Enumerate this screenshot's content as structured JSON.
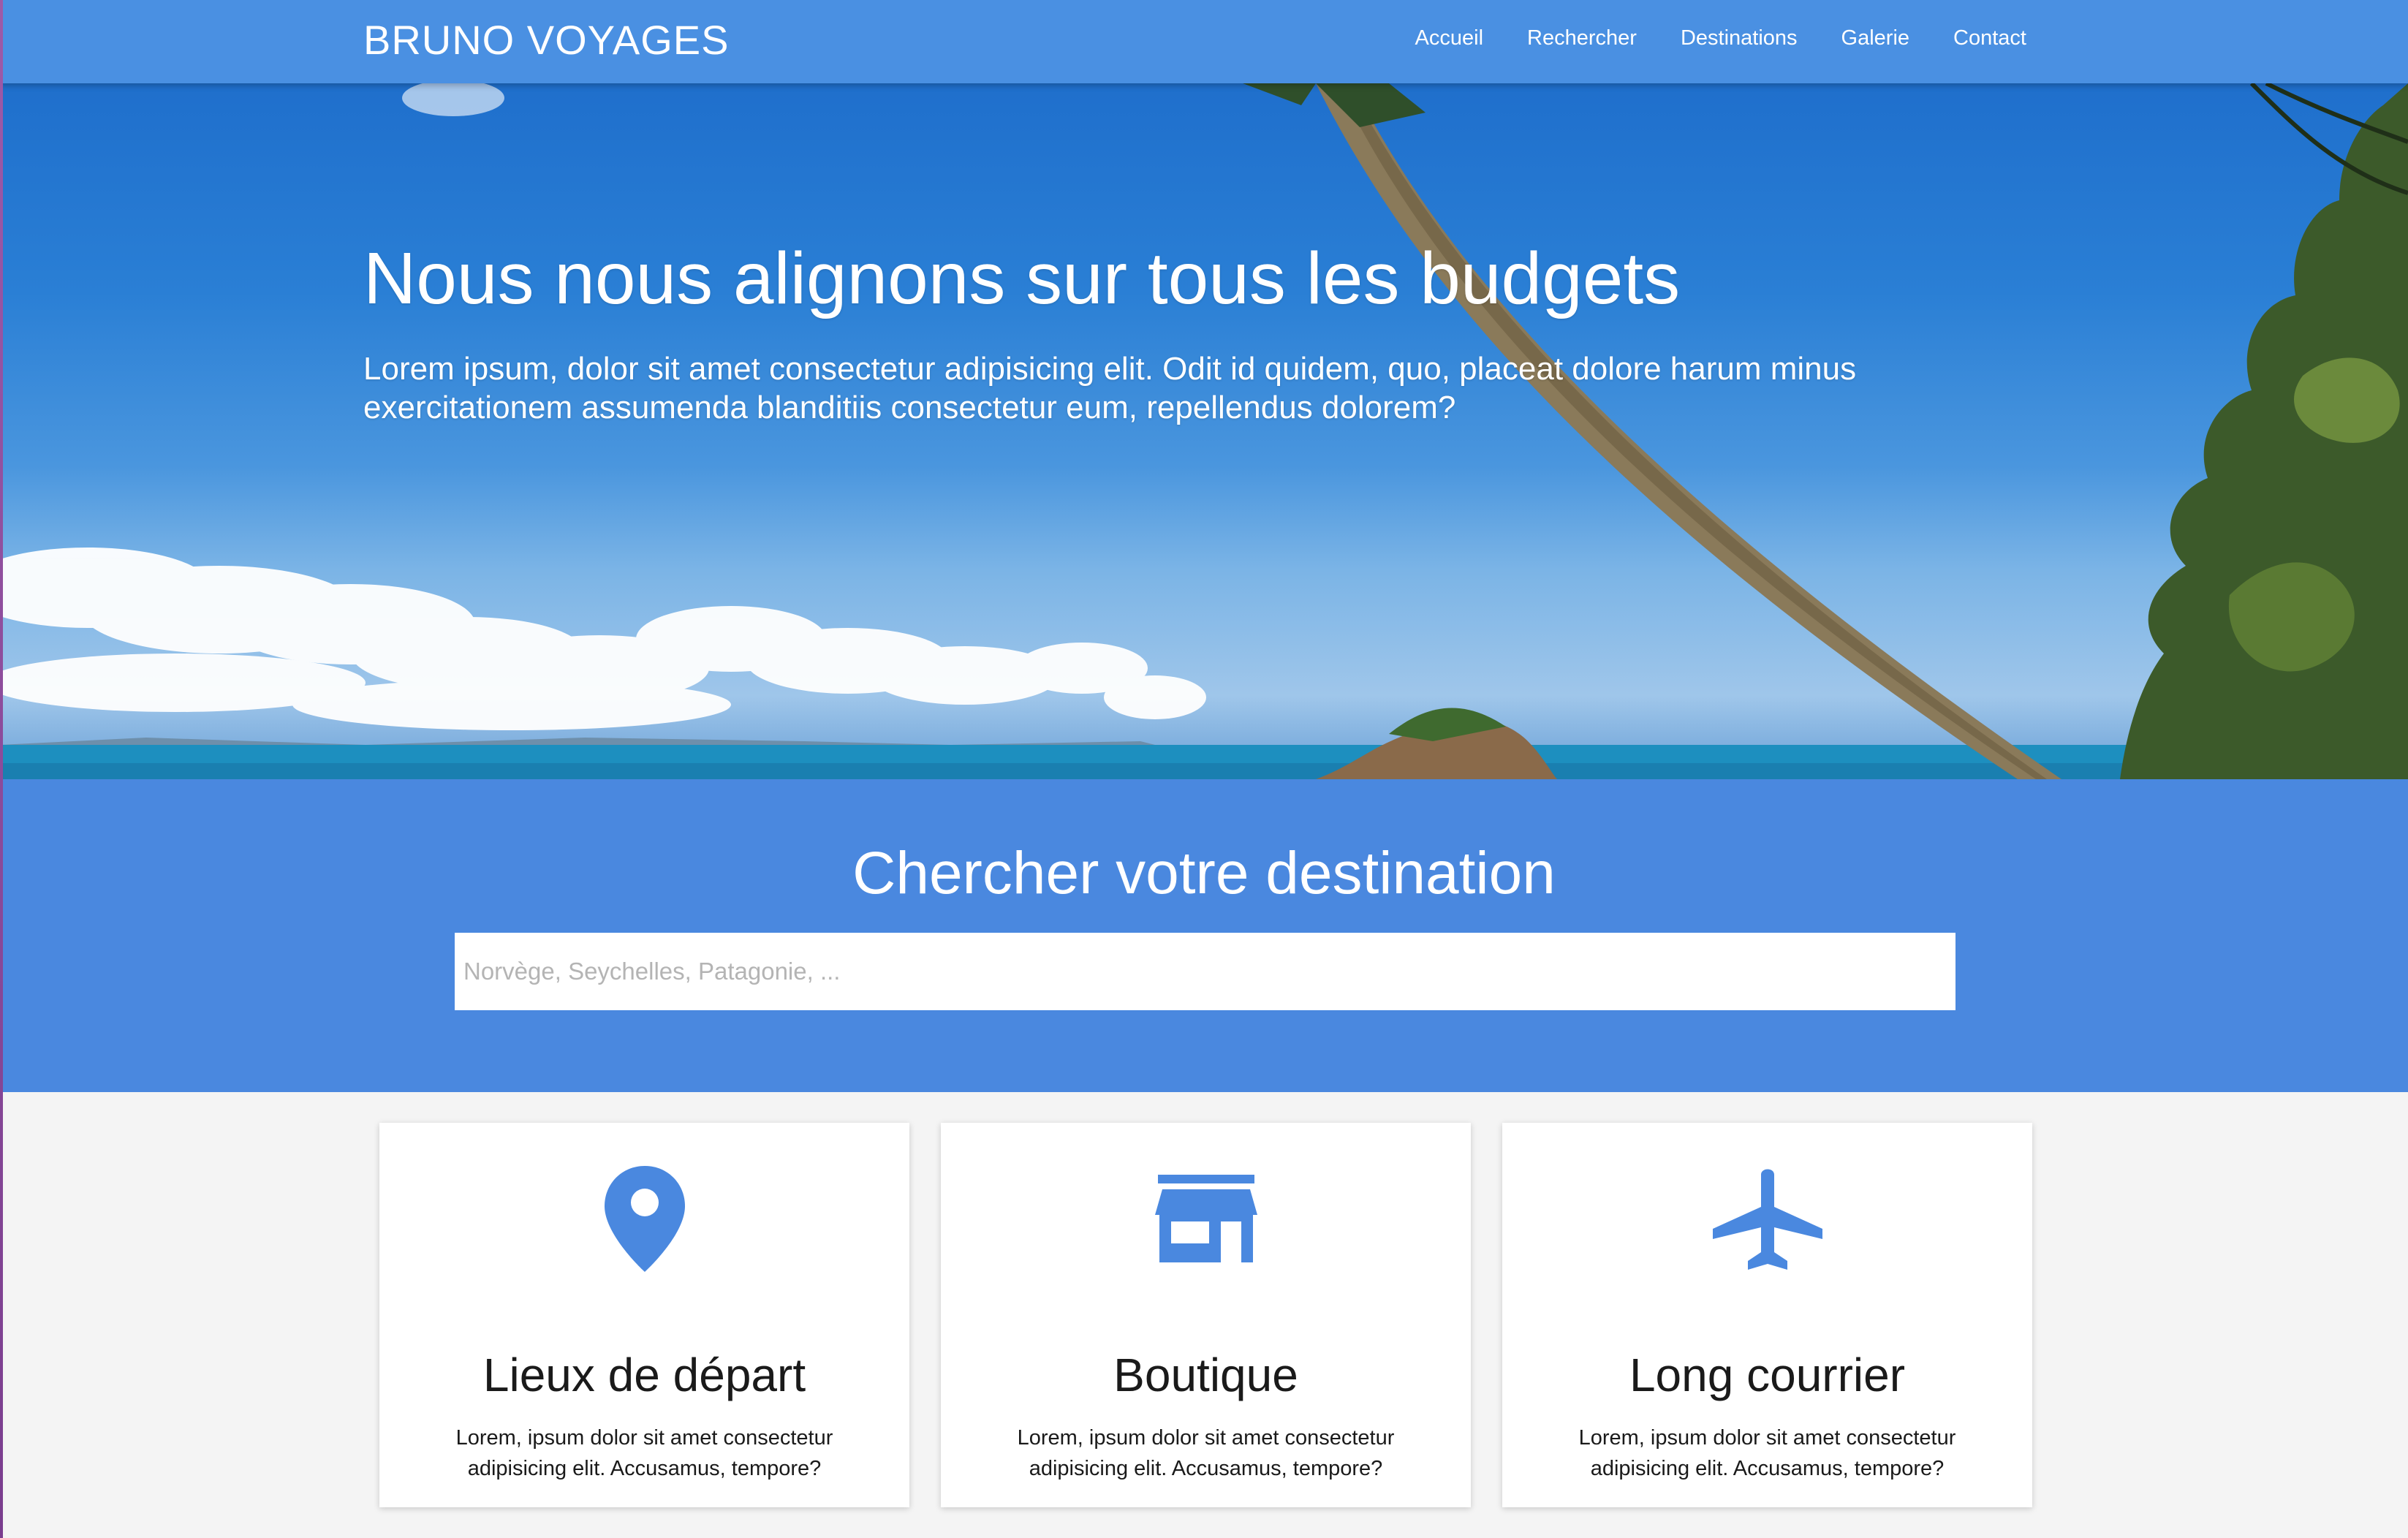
{
  "brand": "BRUNO VOYAGES",
  "nav": [
    {
      "label": "Accueil"
    },
    {
      "label": "Rechercher"
    },
    {
      "label": "Destinations"
    },
    {
      "label": "Galerie"
    },
    {
      "label": "Contact"
    }
  ],
  "hero": {
    "title": "Nous nous alignons sur tous les budgets",
    "text": "Lorem ipsum, dolor sit amet consectetur adipisicing elit. Odit id quidem, quo, placeat dolore harum minus exercitationem assumenda blanditiis consectetur eum, repellendus dolorem?"
  },
  "search": {
    "title": "Chercher votre destination",
    "placeholder": "Norvège, Seychelles, Patagonie, ..."
  },
  "cards": [
    {
      "icon": "map-marker-icon",
      "title": "Lieux de départ",
      "text": "Lorem, ipsum dolor sit amet consectetur adipisicing elit. Accusamus, tempore?"
    },
    {
      "icon": "store-icon",
      "title": "Boutique",
      "text": "Lorem, ipsum dolor sit amet consectetur adipisicing elit. Accusamus, tempore?"
    },
    {
      "icon": "airplane-icon",
      "title": "Long courrier",
      "text": "Lorem, ipsum dolor sit amet consectetur adipisicing elit. Accusamus, tempore?"
    }
  ],
  "colors": {
    "primary": "#4a90e2",
    "search_bg": "#4a88df",
    "page_bg": "#f4f4f4",
    "icon": "#4a88df",
    "text_dark": "#1a1a1a"
  }
}
